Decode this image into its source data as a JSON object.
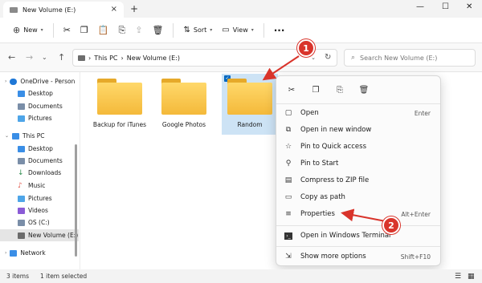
{
  "window": {
    "tab_title": "New Volume (E:)",
    "new_tab": "+",
    "close_tab": "×"
  },
  "toolbar": {
    "new_label": "New",
    "sort_label": "Sort",
    "view_label": "View",
    "more": "···"
  },
  "address": {
    "crumbs": [
      "This PC",
      "New Volume (E:)"
    ],
    "search_placeholder": "Search New Volume (E:)"
  },
  "sidebar": {
    "items": [
      {
        "label": "OneDrive - Person",
        "color": "#1e77d6"
      },
      {
        "label": "Desktop",
        "color": "#3a8ee6"
      },
      {
        "label": "Documents",
        "color": "#7a8ea8"
      },
      {
        "label": "Pictures",
        "color": "#4ea5e8"
      },
      {
        "label": "This PC",
        "color": "#3a8ee6"
      },
      {
        "label": "Desktop",
        "color": "#3a8ee6"
      },
      {
        "label": "Documents",
        "color": "#7a8ea8"
      },
      {
        "label": "Downloads",
        "color": "#2d8c4e"
      },
      {
        "label": "Music",
        "color": "#e2574c"
      },
      {
        "label": "Pictures",
        "color": "#4ea5e8"
      },
      {
        "label": "Videos",
        "color": "#8a5bd6"
      },
      {
        "label": "OS (C:)",
        "color": "#7a8ea8"
      },
      {
        "label": "New Volume (E:)",
        "color": "#6b6b6b"
      },
      {
        "label": "Network",
        "color": "#3a8ee6"
      }
    ]
  },
  "folders": [
    {
      "label": "Backup for iTunes"
    },
    {
      "label": "Google Photos"
    },
    {
      "label": "Random"
    }
  ],
  "context_menu": {
    "items": [
      {
        "label": "Open",
        "shortcut": "Enter"
      },
      {
        "label": "Open in new window",
        "shortcut": ""
      },
      {
        "label": "Pin to Quick access",
        "shortcut": ""
      },
      {
        "label": "Pin to Start",
        "shortcut": ""
      },
      {
        "label": "Compress to ZIP file",
        "shortcut": ""
      },
      {
        "label": "Copy as path",
        "shortcut": ""
      },
      {
        "label": "Properties",
        "shortcut": "Alt+Enter"
      },
      {
        "label": "Open in Windows Terminal",
        "shortcut": ""
      },
      {
        "label": "Show more options",
        "shortcut": "Shift+F10"
      }
    ]
  },
  "status": {
    "count": "3 items",
    "selected": "1 item selected"
  },
  "annotations": {
    "marker1": "1",
    "marker2": "2"
  },
  "colors": {
    "accent": "#0067c0",
    "annotation": "#d9342b"
  }
}
